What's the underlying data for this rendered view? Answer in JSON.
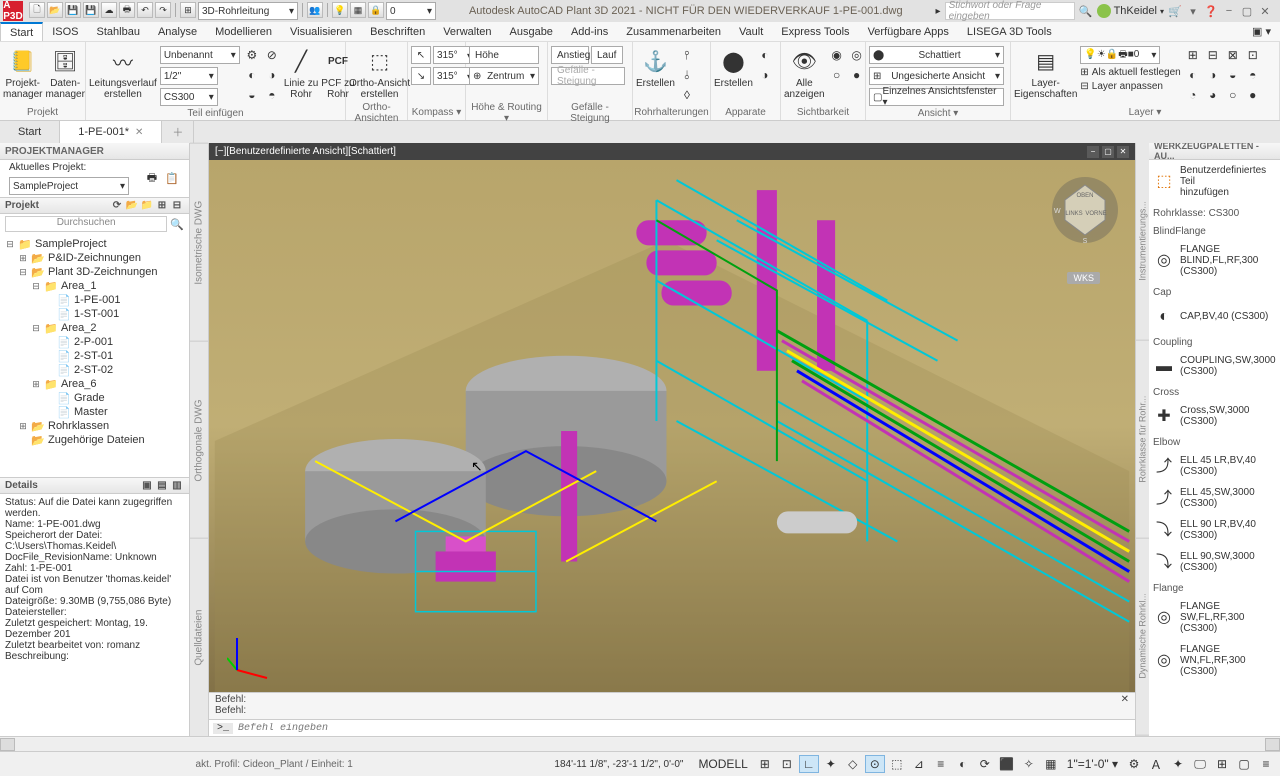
{
  "title": "Autodesk AutoCAD Plant 3D 2021 - NICHT FÜR DEN WIEDERVERKAUF   1-PE-001.dwg",
  "qat_combo1": "3D-Rohrleitung",
  "qat_num": "0",
  "search_placeholder": "Stichwort oder Frage eingeben",
  "user": "ThKeidel",
  "menu": [
    "Start",
    "ISOS",
    "Stahlbau",
    "Analyse",
    "Modellieren",
    "Visualisieren",
    "Beschriften",
    "Verwalten",
    "Ausgabe",
    "Add-ins",
    "Zusammenarbeiten",
    "Vault",
    "Express Tools",
    "Verfügbare Apps",
    "LISEGA 3D Tools"
  ],
  "menu_active": 0,
  "ribbon": {
    "projekt": {
      "btn1": "Projekt-\nmanager",
      "btn2": "Daten-\nmanager",
      "title": "Projekt"
    },
    "teil": {
      "bigbtn": "Leitungsverlauf\nerstellen",
      "combo1": "Unbenannt",
      "combo2": "1/2\"",
      "combo3": "CS300",
      "btn_linie": "Linie zu\nRohr",
      "btn_pcf": "PCF zu\nRohr",
      "title": "Teil einfügen"
    },
    "ortho": {
      "btn": "Ortho-Ansicht\nerstellen",
      "title": "Ortho-Ansichten"
    },
    "kompass": {
      "deg1": "315°",
      "deg2": "315°",
      "title": "Kompass  ▾"
    },
    "hoehe": {
      "lbl1": "Höhe",
      "lbl2": "Zentrum",
      "title": "Höhe & Routing  ▾"
    },
    "gefaelle": {
      "lbl1": "Anstieg",
      "lbl2": "Lauf",
      "lbl3": "Gefälle - Steigung",
      "title": "Gefälle - Steigung"
    },
    "rohrh": {
      "btn": "Erstellen",
      "title": "Rohrhalterungen"
    },
    "apparate": {
      "btn": "Erstellen",
      "title": "Apparate"
    },
    "sicht": {
      "btn": "Alle\nanzeigen",
      "title": "Sichtbarkeit"
    },
    "ansicht": {
      "c1": "Schattiert",
      "c2": "Ungesicherte Ansicht",
      "c3": "Einzelnes Ansichtsfenster ▾",
      "title": "Ansicht  ▾"
    },
    "layer": {
      "btn": "Layer-\nEigenschaften",
      "combo": "",
      "l1": "Als aktuell festlegen",
      "l2": "Layer anpassen",
      "title": "Layer  ▾"
    }
  },
  "doctabs": {
    "start": "Start",
    "current": "1-PE-001*"
  },
  "pm": {
    "header": "PROJEKTMANAGER",
    "curlabel": "Aktuelles Projekt:",
    "curvalue": "SampleProject",
    "proj": "Projekt",
    "search": "Durchsuchen",
    "tree": [
      {
        "lvl": 0,
        "tog": "⊟",
        "icon": "📁",
        "label": "SampleProject"
      },
      {
        "lvl": 1,
        "tog": "⊞",
        "icon": "📂",
        "label": "P&ID-Zeichnungen"
      },
      {
        "lvl": 1,
        "tog": "⊟",
        "icon": "📂",
        "label": "Plant 3D-Zeichnungen"
      },
      {
        "lvl": 2,
        "tog": "⊟",
        "icon": "📁",
        "label": "Area_1"
      },
      {
        "lvl": 3,
        "tog": "",
        "icon": "📄",
        "label": "1-PE-001"
      },
      {
        "lvl": 3,
        "tog": "",
        "icon": "📄",
        "label": "1-ST-001"
      },
      {
        "lvl": 2,
        "tog": "⊟",
        "icon": "📁",
        "label": "Area_2"
      },
      {
        "lvl": 3,
        "tog": "",
        "icon": "📄",
        "label": "2-P-001"
      },
      {
        "lvl": 3,
        "tog": "",
        "icon": "📄",
        "label": "2-ST-01"
      },
      {
        "lvl": 3,
        "tog": "",
        "icon": "📄",
        "label": "2-ST-02"
      },
      {
        "lvl": 2,
        "tog": "⊞",
        "icon": "📁",
        "label": "Area_6"
      },
      {
        "lvl": 3,
        "tog": "",
        "icon": "📄",
        "label": "Grade"
      },
      {
        "lvl": 3,
        "tog": "",
        "icon": "📄",
        "label": "Master"
      },
      {
        "lvl": 1,
        "tog": "⊞",
        "icon": "📂",
        "label": "Rohrklassen"
      },
      {
        "lvl": 1,
        "tog": "",
        "icon": "📂",
        "label": "Zugehörige Dateien"
      }
    ],
    "details": "Details",
    "details_lines": [
      "Status: Auf die Datei kann zugegriffen werden.",
      "Name: 1-PE-001.dwg",
      "Speicherort der Datei: C:\\Users\\Thomas.Keidel\\",
      "DocFile_RevisionName:  Unknown",
      "Zahl: 1-PE-001",
      "Datei ist von Benutzer 'thomas.keidel' auf Com",
      "Dateigröße: 9.30MB (9,755,086 Byte)",
      "Dateiersteller:",
      "Zuletzt gespeichert: Montag, 19. Dezember 201",
      "Zuletzt bearbeitet von: romanz",
      "Beschreibung:"
    ]
  },
  "vp": {
    "tab_label": "[−][Benutzerdefinierte Ansicht][Schattiert]",
    "wcs": "WKS",
    "cmd_hist1": "Befehl:",
    "cmd_hist2": "Befehl:",
    "cmd_prompt": ">_",
    "cmd_placeholder": "Befehl eingeben"
  },
  "vp_sidetabs": [
    "Isometrische DWG",
    "Orthogonale DWG",
    "Quelldateien"
  ],
  "rp": {
    "header": "WERKZEUGPALETTEN - AU...",
    "custom": "Benutzerdefiniertes Teil\nhinzufügen",
    "cat_rohrk": "Rohrklasse: CS300",
    "cat_blind": "BlindFlange",
    "item_blind": "FLANGE BLIND,FL,RF,300 (CS300)",
    "cat_cap": "Cap",
    "item_cap": "CAP,BV,40 (CS300)",
    "cat_coup": "Coupling",
    "item_coup": "COUPLING,SW,3000 (CS300)",
    "cat_cross": "Cross",
    "item_cross": "Cross,SW,3000 (CS300)",
    "cat_elbow": "Elbow",
    "item_e1": "ELL 45 LR,BV,40 (CS300)",
    "item_e2": "ELL 45,SW,3000 (CS300)",
    "item_e3": "ELL 90 LR,BV,40 (CS300)",
    "item_e4": "ELL 90,SW,3000 (CS300)",
    "cat_flange": "Flange",
    "item_f1": "FLANGE SW,FL,RF,300 (CS300)",
    "item_f2": "FLANGE WN,FL,RF,300 (CS300)",
    "tabs": [
      "Instrumentierungs...",
      "Rohrklasse für Rohr...",
      "Dynamische Rohrkl..."
    ]
  },
  "statusbar": {
    "profile": "akt. Profil: Cideon_Plant / Einheit: 1",
    "coords": "184'-11 1/8\", -23'-1 1/2\", 0'-0\"",
    "model": "MODELL"
  }
}
